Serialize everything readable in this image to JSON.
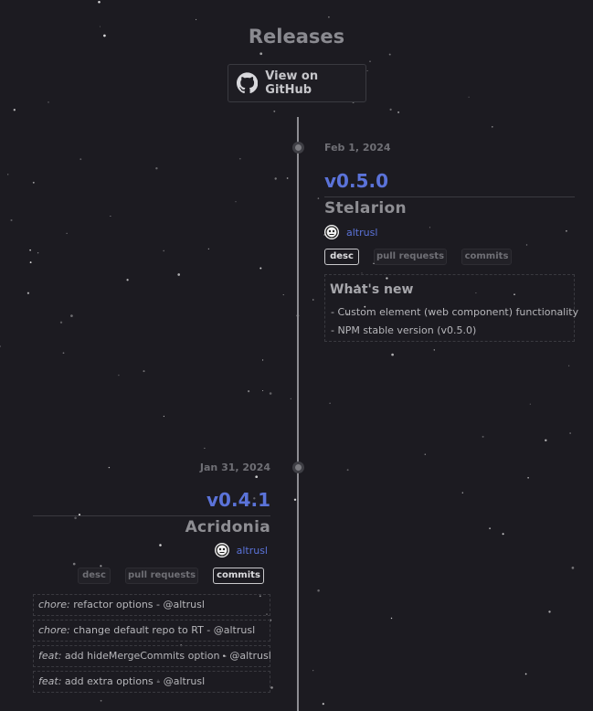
{
  "page": {
    "title": "Releases"
  },
  "github_button": {
    "label": "View on GitHub",
    "icon": "github-icon"
  },
  "releases": [
    {
      "date": "Feb 1, 2024",
      "version": "v0.5.0",
      "codename": "Stelarion",
      "author": "altrusl",
      "tabs": [
        "desc",
        "pull requests",
        "commits"
      ],
      "active_tab": "desc",
      "desc": {
        "heading": "What's new",
        "items": [
          "- Custom element (web component) functionality",
          "- NPM stable version (v0.5.0)"
        ]
      }
    },
    {
      "date": "Jan 31, 2024",
      "version": "v0.4.1",
      "codename": "Acridonia",
      "author": "altrusl",
      "tabs": [
        "desc",
        "pull requests",
        "commits"
      ],
      "active_tab": "commits",
      "commits": [
        {
          "type": "chore:",
          "text": " refactor options - @altrusl"
        },
        {
          "type": "chore:",
          "text": " change default repo to RT - @altrusl"
        },
        {
          "type": "feat:",
          "text": " add hideMergeCommits option - @altrusl"
        },
        {
          "type": "feat:",
          "text": " add extra options - @altrusl"
        }
      ]
    }
  ],
  "colors": {
    "background": "#1c1b21",
    "accent": "#5b73d9",
    "timeline": "#8d8d92"
  }
}
